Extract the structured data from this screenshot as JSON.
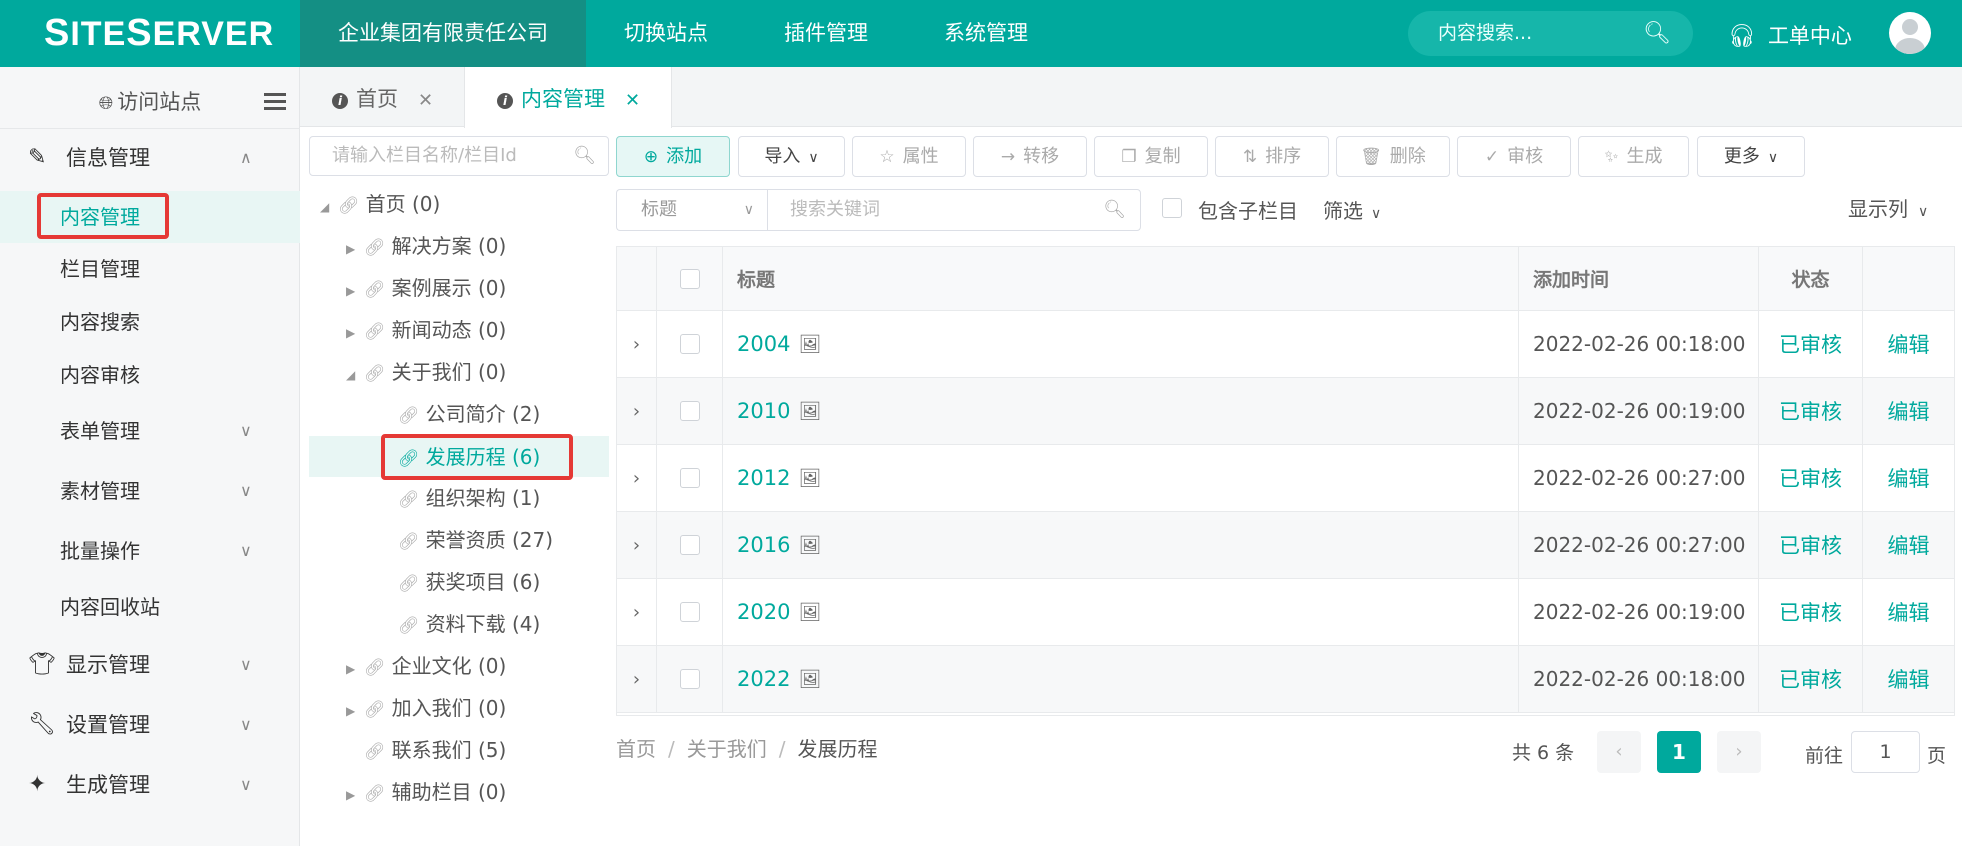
{
  "header": {
    "logo": "SiteServer",
    "nav": [
      "企业集团有限责任公司",
      "切换站点",
      "插件管理",
      "系统管理"
    ],
    "search_placeholder": "内容搜索...",
    "workorder": "工单中心",
    "accent_color": "#00a99d"
  },
  "sidebar": {
    "visit": "访问站点",
    "groups": {
      "info": "信息管理",
      "display": "显示管理",
      "settings": "设置管理",
      "generate": "生成管理"
    },
    "items": [
      "内容管理",
      "栏目管理",
      "内容搜索",
      "内容审核",
      "表单管理",
      "素材管理",
      "批量操作",
      "内容回收站"
    ]
  },
  "tabs": [
    "首页",
    "内容管理"
  ],
  "tree": {
    "search_placeholder": "请输入栏目名称/栏目Id",
    "nodes": [
      "首页 (0)",
      "解决方案 (0)",
      "案例展示 (0)",
      "新闻动态 (0)",
      "关于我们 (0)",
      "公司简介 (2)",
      "发展历程 (6)",
      "组织架构 (1)",
      "荣誉资质 (27)",
      "获奖项目 (6)",
      "资料下载 (4)",
      "企业文化 (0)",
      "加入我们 (0)",
      "联系我们 (5)",
      "辅助栏目 (0)"
    ]
  },
  "toolbar": {
    "add": "添加",
    "import": "导入",
    "attributes": "属性",
    "move": "转移",
    "copy": "复制",
    "sort": "排序",
    "delete": "删除",
    "audit": "审核",
    "generate": "生成",
    "more": "更多"
  },
  "filter": {
    "field_select": "标题",
    "keyword_placeholder": "搜索关键词",
    "include_children": "包含子栏目",
    "filter_label": "筛选",
    "columns_label": "显示列"
  },
  "table": {
    "headers": {
      "title": "标题",
      "added": "添加时间",
      "status": "状态"
    },
    "rows": [
      {
        "title": "2004",
        "time": "2022-02-26 00:18:00",
        "status": "已审核",
        "action": "编辑"
      },
      {
        "title": "2010",
        "time": "2022-02-26 00:19:00",
        "status": "已审核",
        "action": "编辑"
      },
      {
        "title": "2012",
        "time": "2022-02-26 00:27:00",
        "status": "已审核",
        "action": "编辑"
      },
      {
        "title": "2016",
        "time": "2022-02-26 00:27:00",
        "status": "已审核",
        "action": "编辑"
      },
      {
        "title": "2020",
        "time": "2022-02-26 00:19:00",
        "status": "已审核",
        "action": "编辑"
      },
      {
        "title": "2022",
        "time": "2022-02-26 00:18:00",
        "status": "已审核",
        "action": "编辑"
      }
    ]
  },
  "breadcrumb": [
    "首页",
    "关于我们",
    "发展历程"
  ],
  "pagination": {
    "total": "共 6 条",
    "current": "1",
    "goto_label": "前往",
    "goto_value": "1",
    "page_suffix": "页"
  }
}
